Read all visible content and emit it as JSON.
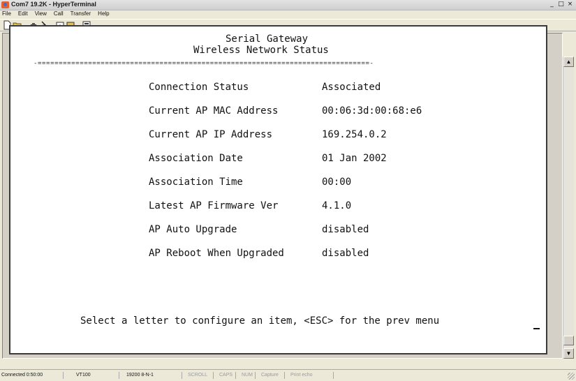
{
  "window": {
    "title": "Com7 19.2K - HyperTerminal",
    "controls": [
      "_",
      "□",
      "×"
    ]
  },
  "menu": [
    "File",
    "Edit",
    "View",
    "Call",
    "Transfer",
    "Help"
  ],
  "toolbar": {
    "icons": [
      "new-icon",
      "open-icon",
      "connect-icon",
      "disconnect-icon",
      "send-icon",
      "receive-icon",
      "properties-icon"
    ]
  },
  "terminal": {
    "heading_line1": "Serial Gateway",
    "heading_line2": "Wireless Network Status",
    "divider": "-===============================================================================-",
    "rows": [
      {
        "label": "Connection Status",
        "value": "Associated"
      },
      {
        "label": "Current AP MAC Address",
        "value": "00:06:3d:00:68:e6"
      },
      {
        "label": "Current AP IP Address",
        "value": "169.254.0.2"
      },
      {
        "label": "Association Date",
        "value": "01 Jan 2002"
      },
      {
        "label": "Association Time",
        "value": "00:00"
      },
      {
        "label": "Latest AP Firmware Ver",
        "value": "4.1.0"
      },
      {
        "label": "AP Auto Upgrade",
        "value": "disabled"
      },
      {
        "label": "AP Reboot When Upgraded",
        "value": "disabled"
      }
    ],
    "prompt": "Select a letter to configure an item, <ESC> for the prev menu"
  },
  "statusbar": {
    "connected": "Connected 0:50:00",
    "emulation": "VT100",
    "port_settings": "19200 8-N-1",
    "scroll": "SCROLL",
    "caps": "CAPS",
    "num": "NUM",
    "capture": "Capture",
    "print_echo": "Print echo"
  }
}
